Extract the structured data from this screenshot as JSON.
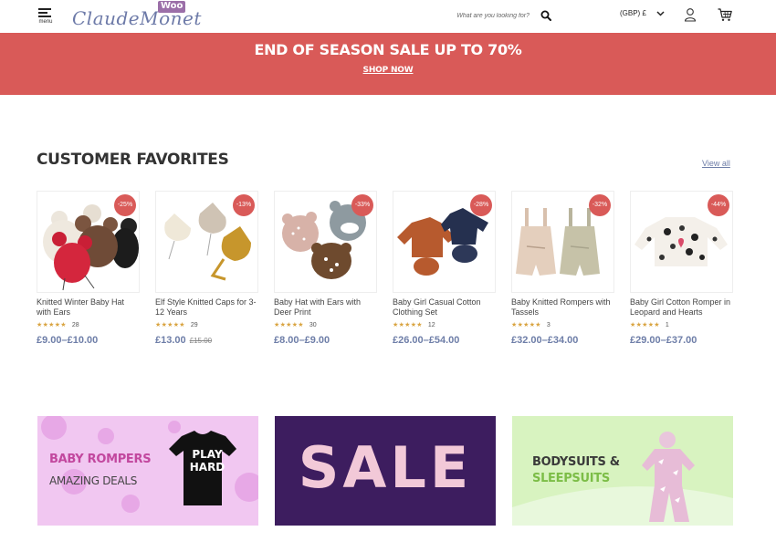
{
  "header": {
    "menu_label": "menu",
    "logo_text": "ClaudeMonet",
    "logo_badge": "Woo",
    "search_placeholder": "What are you looking for?",
    "currency": "(GBP) £",
    "icons": [
      "menu-icon",
      "search-icon",
      "chevron-down-icon",
      "user-icon",
      "cart-icon"
    ]
  },
  "banner": {
    "title": "END OF SEASON SALE UP TO 70%",
    "link": "SHOP NOW",
    "color": "#d95a58"
  },
  "section": {
    "title": "CUSTOMER FAVORITES",
    "view_all": "View all"
  },
  "products": [
    {
      "name": "Knitted Winter Baby Hat with Ears",
      "badge": "-25%",
      "stars": "★★★★★",
      "reviews": "28",
      "price": "£9.00–£10.00",
      "old_price": ""
    },
    {
      "name": "Elf Style Knitted Caps for 3-12 Years",
      "badge": "-13%",
      "stars": "★★★★★",
      "reviews": "29",
      "price": "£13.00",
      "old_price": "£15.00"
    },
    {
      "name": "Baby Hat with Ears with Deer Print",
      "badge": "-33%",
      "stars": "★★★★★",
      "reviews": "30",
      "price": "£8.00–£9.00",
      "old_price": ""
    },
    {
      "name": "Baby Girl Casual Cotton Clothing Set",
      "badge": "-28%",
      "stars": "★★★★★",
      "reviews": "12",
      "price": "£26.00–£54.00",
      "old_price": ""
    },
    {
      "name": "Baby Knitted Rompers with Tassels",
      "badge": "-32%",
      "stars": "★★★★★",
      "reviews": "3",
      "price": "£32.00–£34.00",
      "old_price": ""
    },
    {
      "name": "Baby Girl Cotton Romper in Leopard and Hearts",
      "badge": "-44%",
      "stars": "★★★★★",
      "reviews": "1",
      "price": "£29.00–£37.00",
      "old_price": ""
    }
  ],
  "promos": {
    "rompers_title": "BABY ROMPERS",
    "rompers_sub": "AMAZING DEALS",
    "onesie_text": "PLAY HARD",
    "sale_word": "SALE",
    "bodysuits_line1": "BODYSUITS &",
    "bodysuits_line2": "SLEEPSUITS"
  },
  "colors": {
    "accent": "#6e7ea8",
    "badge": "#d95a58",
    "stars": "#d9a441"
  }
}
